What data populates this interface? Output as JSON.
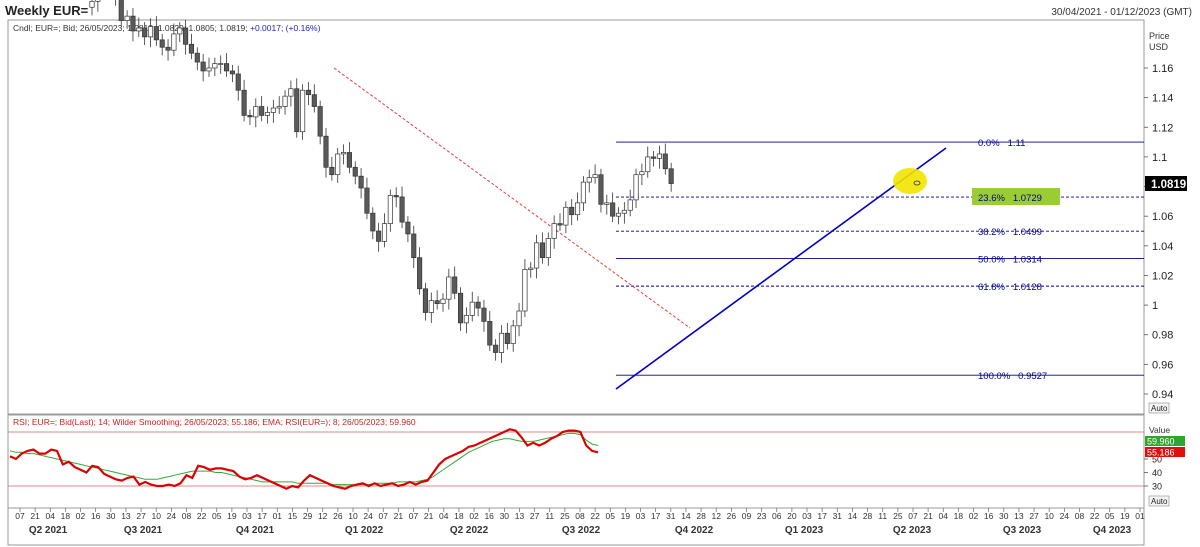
{
  "header": {
    "title": "Weekly EUR=",
    "date_range": "30/04/2021 - 01/12/2023 (GMT)",
    "legend_prefix": "Cndl; EUR=; Bid; 26/05/2023; 1.0813; 1.0829; 1.0805; 1.0819; ",
    "legend_change": "+0.0017; (+0.16%)"
  },
  "price_axis": {
    "title_line1": "Price",
    "title_line2": "USD",
    "last_price": "1.0819",
    "auto_label": "Auto"
  },
  "rsi_panel": {
    "legend": "RSI; EUR=; Bid(Last); 14; Wilder Smoothing; 26/05/2023; 55.186; EMA; RSI(EUR=); 8; 26/05/2023; 59.960",
    "value_label": "Value",
    "ema_value": "59.960",
    "rsi_value": "55.186",
    "auto_label": "Auto"
  },
  "colors": {
    "candle_fill": "#5a5a5a",
    "rsi_line": "#dd0000",
    "ema_line": "#3aa63a",
    "fib_line": "#00008b",
    "trendline": "#0000cc",
    "downtrend": "#e04040",
    "highlight_label": "#9acd32",
    "marker": "#f0e000"
  },
  "chart_data": [
    {
      "type": "candlestick",
      "title": "Weekly EUR=",
      "ylabel": "Price USD",
      "yticks": [
        0.94,
        0.96,
        0.98,
        1,
        1.02,
        1.04,
        1.06,
        1.08,
        1.1,
        1.12,
        1.14,
        1.16
      ],
      "ylim": [
        0.93,
        1.18
      ],
      "close_series": [
        1.205,
        1.215,
        1.218,
        1.214,
        1.209,
        1.192,
        1.195,
        1.185,
        1.187,
        1.181,
        1.188,
        1.179,
        1.174,
        1.172,
        1.183,
        1.187,
        1.176,
        1.17,
        1.164,
        1.158,
        1.16,
        1.163,
        1.163,
        1.158,
        1.156,
        1.145,
        1.128,
        1.127,
        1.134,
        1.128,
        1.13,
        1.133,
        1.134,
        1.141,
        1.146,
        1.117,
        1.145,
        1.142,
        1.134,
        1.114,
        1.093,
        1.088,
        1.102,
        1.103,
        1.093,
        1.087,
        1.079,
        1.062,
        1.05,
        1.043,
        1.055,
        1.074,
        1.073,
        1.056,
        1.048,
        1.032,
        1.011,
        0.995,
        1.003,
        1.001,
        1.004,
        1.019,
        1.008,
        0.988,
        0.993,
        1.002,
        0.998,
        0.989,
        0.973,
        0.968,
        0.981,
        0.974,
        0.986,
        0.996,
        1.024,
        1.025,
        1.042,
        1.032,
        1.045,
        1.055,
        1.054,
        1.066,
        1.061,
        1.069,
        1.083,
        1.086,
        1.088,
        1.068,
        1.069,
        1.06,
        1.062,
        1.064,
        1.071,
        1.088,
        1.09,
        1.1,
        1.099,
        1.102,
        1.092,
        1.082
      ],
      "last_close": 1.0819,
      "fibonacci_levels": [
        {
          "label": "0.0%",
          "value": "1.11"
        },
        {
          "label": "23.6%",
          "value": "1.0729"
        },
        {
          "label": "38.2%",
          "value": "1.0499"
        },
        {
          "label": "50.0%",
          "value": "1.0314"
        },
        {
          "label": "61.8%",
          "value": "1.0128"
        },
        {
          "label": "100.0%",
          "value": "0.9527"
        }
      ]
    },
    {
      "type": "line",
      "ylim": [
        20,
        80
      ],
      "yticks": [
        30,
        40,
        50
      ],
      "series": [
        {
          "name": "RSI",
          "values": [
            52,
            50,
            54,
            56,
            57,
            54,
            54,
            57,
            56,
            46,
            48,
            44,
            42,
            40,
            45,
            44,
            39,
            37,
            35,
            34,
            36,
            37,
            31,
            33,
            31,
            30,
            30,
            31,
            30,
            32,
            38,
            36,
            45,
            44,
            42,
            43,
            43,
            42,
            41,
            37,
            35,
            36,
            38,
            36,
            34,
            32,
            30,
            28,
            30,
            29,
            34,
            38,
            36,
            34,
            32,
            30,
            29,
            28,
            30,
            31,
            32,
            30,
            32,
            30,
            31,
            32,
            30,
            31,
            33,
            31,
            33,
            34,
            40,
            46,
            50,
            52,
            54,
            56,
            59,
            60,
            62,
            64,
            66,
            68,
            70,
            72,
            71,
            66,
            60,
            62,
            60,
            62,
            65,
            67,
            70,
            71,
            71,
            70,
            60,
            56,
            55
          ]
        },
        {
          "name": "EMA",
          "values": [
            56,
            55,
            55,
            54,
            54,
            53,
            52,
            51,
            50,
            49,
            48,
            47,
            46,
            45,
            44,
            43,
            42,
            41,
            40,
            39,
            38,
            37,
            36,
            35,
            35,
            35,
            36,
            37,
            38,
            39,
            40,
            41,
            41,
            41,
            41,
            40,
            40,
            39,
            38,
            37,
            36,
            35,
            34,
            33,
            33,
            33,
            33,
            33,
            33,
            32,
            32,
            32,
            32,
            32,
            32,
            31,
            31,
            31,
            31,
            31,
            31,
            31,
            32,
            32,
            32,
            32,
            33,
            33,
            33,
            33,
            34,
            35,
            37,
            40,
            43,
            46,
            49,
            52,
            55,
            57,
            59,
            61,
            63,
            64,
            65,
            65,
            64,
            63,
            63,
            63,
            64,
            65,
            66,
            67,
            68,
            69,
            69,
            68,
            64,
            61,
            60
          ]
        }
      ],
      "overbought": 70,
      "oversold": 30
    }
  ],
  "x_axis": {
    "day_ticks": [
      "07",
      "21",
      "04",
      "18",
      "02",
      "16",
      "30",
      "13",
      "27",
      "10",
      "24",
      "08",
      "22",
      "05",
      "19",
      "03",
      "17",
      "01",
      "15",
      "29",
      "12",
      "26",
      "10",
      "24",
      "07",
      "21",
      "07",
      "21",
      "04",
      "18",
      "02",
      "16",
      "30",
      "13",
      "27",
      "11",
      "25",
      "08",
      "22",
      "05",
      "19",
      "03",
      "17",
      "31",
      "14",
      "28",
      "12",
      "26",
      "09",
      "23",
      "06",
      "20",
      "03",
      "17",
      "31",
      "14",
      "28",
      "11",
      "25",
      "07",
      "21",
      "04",
      "18",
      "02",
      "16",
      "30",
      "13",
      "27",
      "10",
      "24",
      "08",
      "22",
      "05",
      "19",
      "01"
    ],
    "quarter_ticks": [
      "Q2 2021",
      "Q3 2021",
      "Q4 2021",
      "Q1 2022",
      "Q2 2022",
      "Q3 2022",
      "Q4 2022",
      "Q1 2023",
      "Q2 2023",
      "Q3 2023",
      "Q4 2023"
    ]
  }
}
